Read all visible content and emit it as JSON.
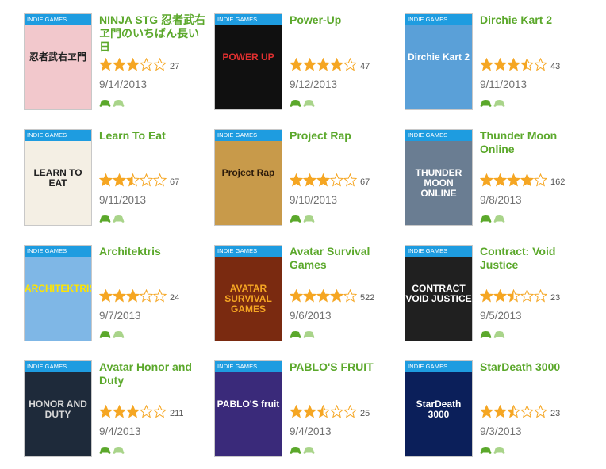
{
  "colors": {
    "accent": "#5ba82b",
    "band": "#1e9ce0",
    "star": "#f5a623"
  },
  "band_label": "INDIE GAMES",
  "games": [
    {
      "title": "NINJA STG 忍者武右ヱ門のいちばん長い日",
      "rating": 3,
      "count": "27",
      "date": "9/14/2013",
      "cover_text": "忍者武右ヱ門",
      "cover_bg": "#f2c8cc",
      "cover_fg": "#222"
    },
    {
      "title": "Power-Up",
      "rating": 4,
      "count": "47",
      "date": "9/12/2013",
      "cover_text": "POWER UP",
      "cover_bg": "#101010",
      "cover_fg": "#e23030"
    },
    {
      "title": "Dirchie Kart 2",
      "rating": 3.5,
      "count": "43",
      "date": "9/11/2013",
      "cover_text": "Dirchie Kart 2",
      "cover_bg": "#5aa0d8",
      "cover_fg": "#ffffff"
    },
    {
      "title": "Learn To Eat",
      "rating": 2.5,
      "count": "67",
      "date": "9/11/2013",
      "cover_text": "LEARN TO EAT",
      "cover_bg": "#f4efe4",
      "cover_fg": "#222"
    },
    {
      "title": "Project Rap",
      "rating": 3,
      "count": "67",
      "date": "9/10/2013",
      "cover_text": "Project Rap",
      "cover_bg": "#c89a4a",
      "cover_fg": "#2b1a0a"
    },
    {
      "title": "Thunder Moon Online",
      "rating": 4,
      "count": "162",
      "date": "9/8/2013",
      "cover_text": "THUNDER MOON ONLINE",
      "cover_bg": "#6a7d92",
      "cover_fg": "#ffffff"
    },
    {
      "title": "Architektris",
      "rating": 3,
      "count": "24",
      "date": "9/7/2013",
      "cover_text": "ARCHITEKTRIS",
      "cover_bg": "#7fb7e6",
      "cover_fg": "#ffe400"
    },
    {
      "title": "Avatar Survival Games",
      "rating": 4,
      "count": "522",
      "date": "9/6/2013",
      "cover_text": "AVATAR SURVIVAL GAMES",
      "cover_bg": "#7a2a10",
      "cover_fg": "#f6a623"
    },
    {
      "title": "Contract: Void Justice",
      "rating": 2.5,
      "count": "23",
      "date": "9/5/2013",
      "cover_text": "CONTRACT VOID JUSTICE",
      "cover_bg": "#202020",
      "cover_fg": "#ffffff"
    },
    {
      "title": "Avatar Honor and Duty",
      "rating": 3,
      "count": "211",
      "date": "9/4/2013",
      "cover_text": "HONOR AND DUTY",
      "cover_bg": "#1e2a3a",
      "cover_fg": "#d8d8d8"
    },
    {
      "title": "PABLO'S FRUIT",
      "rating": 2.5,
      "count": "25",
      "date": "9/4/2013",
      "cover_text": "PABLO'S fruit",
      "cover_bg": "#3a2a7a",
      "cover_fg": "#ffffff"
    },
    {
      "title": "StarDeath 3000",
      "rating": 2.5,
      "count": "23",
      "date": "9/3/2013",
      "cover_text": "StarDeath 3000",
      "cover_bg": "#0b1f5a",
      "cover_fg": "#ffffff"
    }
  ]
}
